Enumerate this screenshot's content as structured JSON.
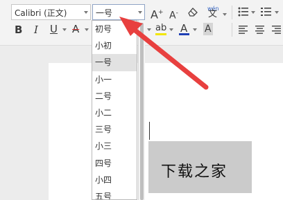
{
  "toolbar": {
    "font_name": "Calibri (正文)",
    "font_size": "一号",
    "grow_font": "A",
    "grow_sup": "+",
    "shrink_font": "A",
    "shrink_sup": "-",
    "pinyin_top": "wén",
    "pinyin_char": "文",
    "bold": "B",
    "italic": "I",
    "underline": "U",
    "strike": "A",
    "highlight": "ab",
    "font_color": "A",
    "char_shade": "A"
  },
  "font_size_options": [
    "初号",
    "小初",
    "一号",
    "小一",
    "二号",
    "小二",
    "三号",
    "小三",
    "四号",
    "小四",
    "五号"
  ],
  "selected_size": "一号",
  "document": {
    "text": "下载之家"
  },
  "colors": {
    "annotation_arrow": "#e8403f",
    "font_color_bar": "#1f3fb5",
    "highlight_bar": "#f2e600",
    "strike_red": "#e23b3b"
  }
}
